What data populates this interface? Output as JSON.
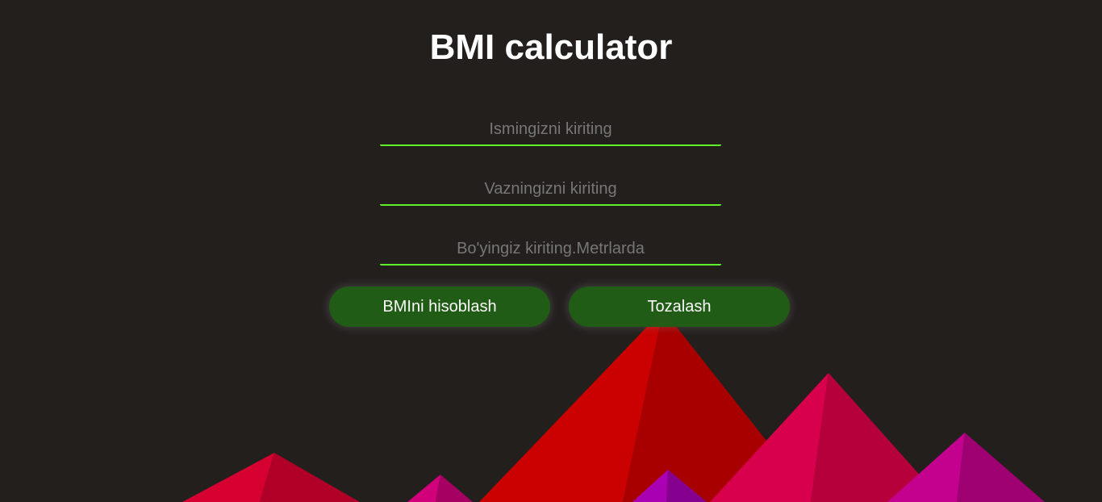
{
  "page": {
    "title": "BMI calculator"
  },
  "form": {
    "name_placeholder": "Ismingizni kiriting",
    "name_value": "",
    "weight_placeholder": "Vazningizni kiriting",
    "weight_value": "",
    "height_placeholder": "Bo'yingiz kiriting.Metrlarda",
    "height_value": ""
  },
  "buttons": {
    "calculate_label": "BMIni hisoblash",
    "clear_label": "Tozalash"
  },
  "colors": {
    "background": "#221f1d",
    "accent_underline": "#5ef02a",
    "button": "#215e17"
  }
}
